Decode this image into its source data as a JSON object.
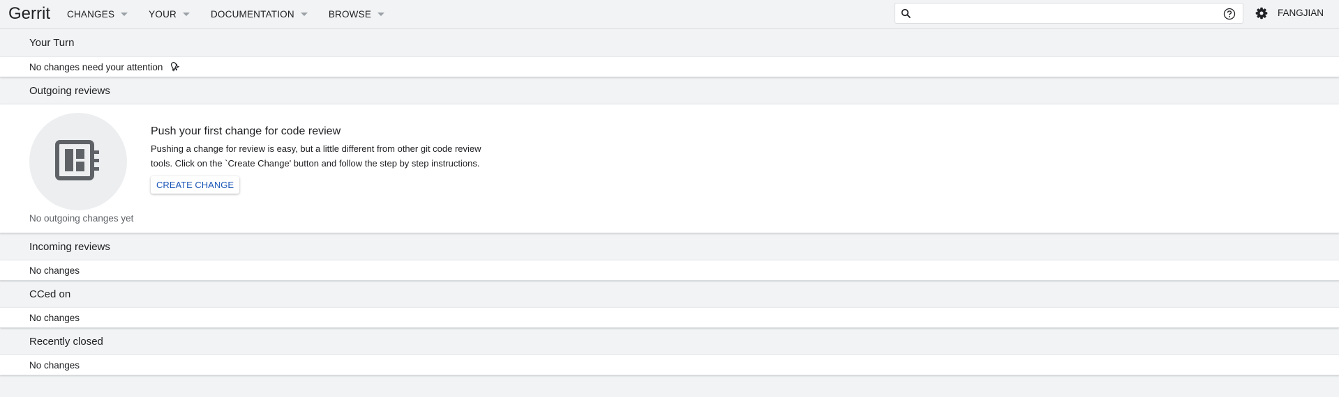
{
  "header": {
    "brand": "Gerrit",
    "nav": [
      {
        "label": "CHANGES"
      },
      {
        "label": "YOUR"
      },
      {
        "label": "DOCUMENTATION"
      },
      {
        "label": "BROWSE"
      }
    ],
    "search": {
      "value": "",
      "placeholder": ""
    },
    "account": "FANGJIAN"
  },
  "sections": {
    "your_turn": {
      "title": "Your Turn",
      "empty": "No changes need your attention"
    },
    "outgoing": {
      "title": "Outgoing reviews",
      "empty": "No outgoing changes yet",
      "promo_title": "Push your first change for code review",
      "promo_text": "Pushing a change for review is easy, but a little different from other git code review tools. Click on the `Create Change' button and follow the step by step instructions.",
      "button": "CREATE CHANGE"
    },
    "incoming": {
      "title": "Incoming reviews",
      "empty": "No changes"
    },
    "cced": {
      "title": "CCed on",
      "empty": "No changes"
    },
    "closed": {
      "title": "Recently closed",
      "empty": "No changes"
    }
  },
  "colors": {
    "page_bg": "#f1f3f4",
    "accent_link": "#1a56b6",
    "icon_grey": "#5f6368"
  },
  "icons": {
    "search": "search-icon",
    "help": "help-icon",
    "settings": "gear-icon",
    "attention": "bell-icon",
    "illustration": "dashboard-illustration-icon"
  }
}
